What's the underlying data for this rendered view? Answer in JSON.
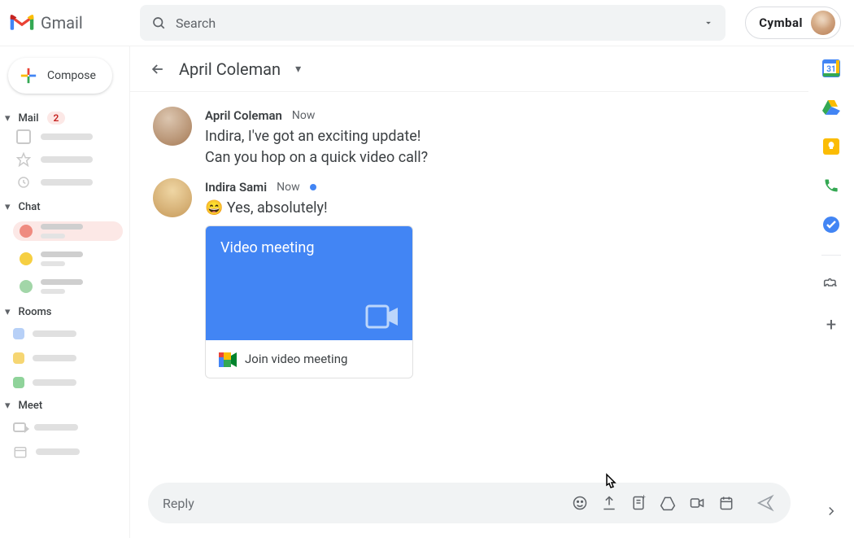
{
  "header": {
    "app_name": "Gmail",
    "search_placeholder": "Search",
    "account_brand": "Cymbal"
  },
  "sidebar": {
    "compose_label": "Compose",
    "mail": {
      "label": "Mail",
      "badge": "2"
    },
    "chat": {
      "label": "Chat"
    },
    "rooms": {
      "label": "Rooms"
    },
    "meet": {
      "label": "Meet"
    },
    "chat_items": [
      {
        "color": "#ef8b80",
        "active": true
      },
      {
        "color": "#f6cf42",
        "active": false
      },
      {
        "color": "#a2d6a8",
        "active": false
      }
    ],
    "room_items": [
      {
        "color": "#b7d0f7"
      },
      {
        "color": "#f6d673"
      },
      {
        "color": "#8fd39a"
      }
    ]
  },
  "chat": {
    "title": "April Coleman",
    "messages": [
      {
        "sender": "April Coleman",
        "time": "Now",
        "lines": [
          "Indira, I've got an exciting update!",
          "Can you hop on a quick video call?"
        ],
        "has_indicator": false
      },
      {
        "sender": "Indira Sami",
        "time": "Now",
        "lines": [
          "😄 Yes, absolutely!"
        ],
        "has_indicator": true
      }
    ],
    "card": {
      "title": "Video meeting",
      "action": "Join video meeting"
    },
    "reply_placeholder": "Reply"
  },
  "sidepanel": {
    "calendar_date": "31"
  }
}
